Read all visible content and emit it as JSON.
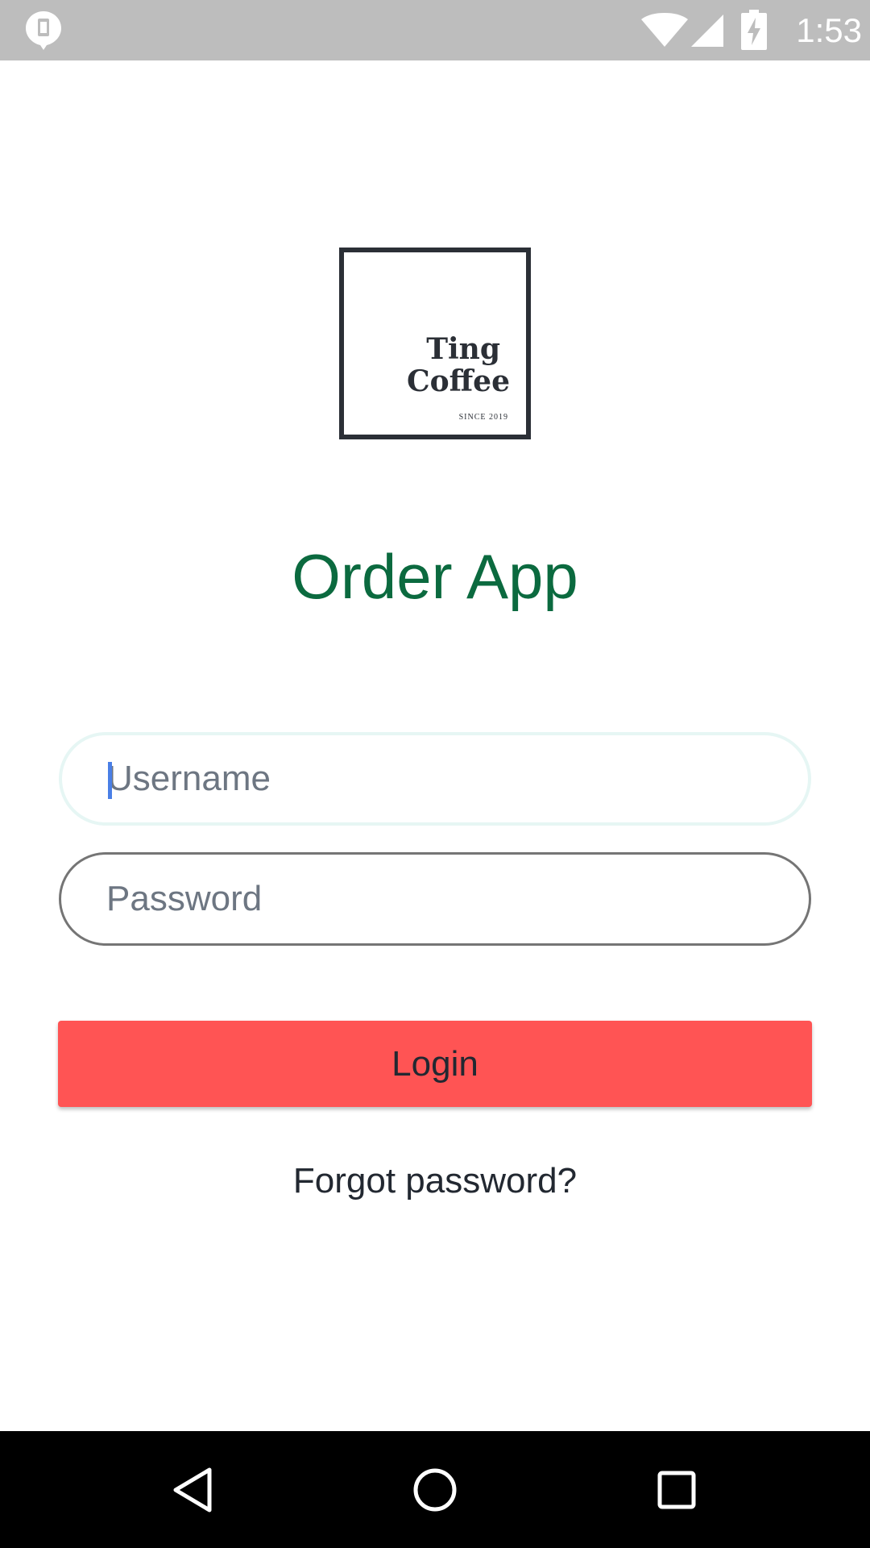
{
  "status_bar": {
    "time": "1:53",
    "icons": [
      "notification-icon",
      "wifi-icon",
      "signal-icon",
      "battery-charging-icon"
    ]
  },
  "logo": {
    "line1": "Ting",
    "line2": "Coffee",
    "since": "SINCE 2019"
  },
  "app": {
    "title": "Order App",
    "title_color": "#0b6a3f"
  },
  "form": {
    "username_placeholder": "Username",
    "username_value": "",
    "password_placeholder": "Password",
    "password_value": "",
    "login_label": "Login",
    "login_color": "#ff5454",
    "forgot_label": "Forgot password?"
  },
  "nav_bar": {
    "icons": [
      "back-icon",
      "home-icon",
      "recents-icon"
    ]
  }
}
